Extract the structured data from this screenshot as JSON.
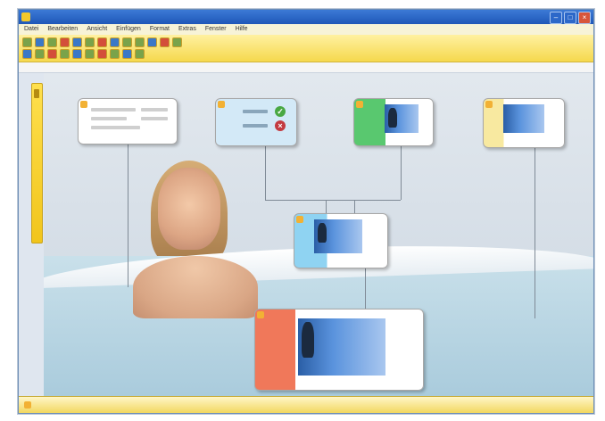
{
  "window": {
    "title": "",
    "buttons": [
      "–",
      "□",
      "×"
    ]
  },
  "menu": [
    "Datei",
    "Bearbeiten",
    "Ansicht",
    "Einfügen",
    "Format",
    "Extras",
    "Fenster",
    "Hilfe"
  ],
  "toolbar": {
    "row1": [
      "",
      "",
      "",
      "",
      "",
      "",
      "",
      ""
    ],
    "row2": [
      "",
      "",
      "",
      "",
      "",
      "",
      "",
      ""
    ],
    "right_label": ""
  },
  "path": {
    "text": "",
    "mode": ""
  },
  "nodes": {
    "node1_caption": "",
    "node2_caption": "",
    "node3_caption": "",
    "node4_caption": "",
    "node5_caption": "",
    "node6_caption": ""
  },
  "status": {
    "left": "",
    "mid": "",
    "right": ""
  },
  "colors": {
    "accent": "#f2b134",
    "green": "#49a843",
    "red": "#c33b41"
  }
}
